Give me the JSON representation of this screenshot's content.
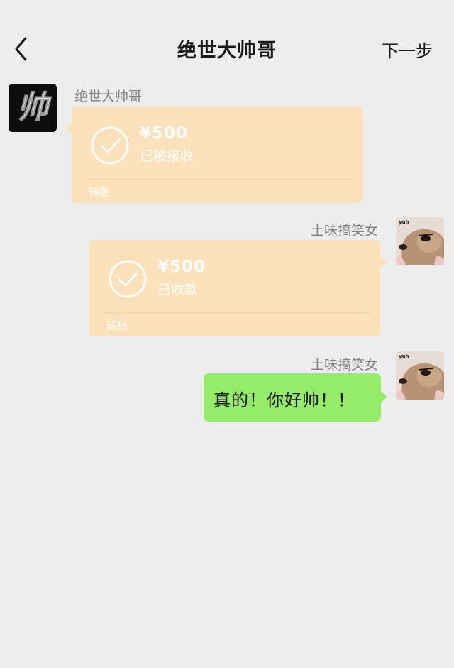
{
  "header": {
    "title": "绝世大帅哥",
    "next_label": "下一步"
  },
  "chat": {
    "contact": {
      "name": "绝世大帅哥",
      "avatar_text": "帅"
    },
    "me": {
      "name": "土味搞笑女",
      "avatar_text": "yuh"
    },
    "messages": [
      {
        "sender": "绝世大帅哥",
        "type": "transfer",
        "amount": "¥500",
        "status": "已被接收",
        "label": "转账"
      },
      {
        "sender": "土味搞笑女",
        "type": "transfer",
        "amount": "¥500",
        "status": "已收款",
        "label": "转账"
      },
      {
        "sender": "土味搞笑女",
        "type": "text",
        "text": "真的！你好帅！！"
      }
    ]
  },
  "colors": {
    "background": "#ededed",
    "transfer_bubble": "#fbe1b9",
    "text_bubble": "#95ec69"
  },
  "icons": [
    "back-arrow-icon",
    "check-circle-icon"
  ]
}
